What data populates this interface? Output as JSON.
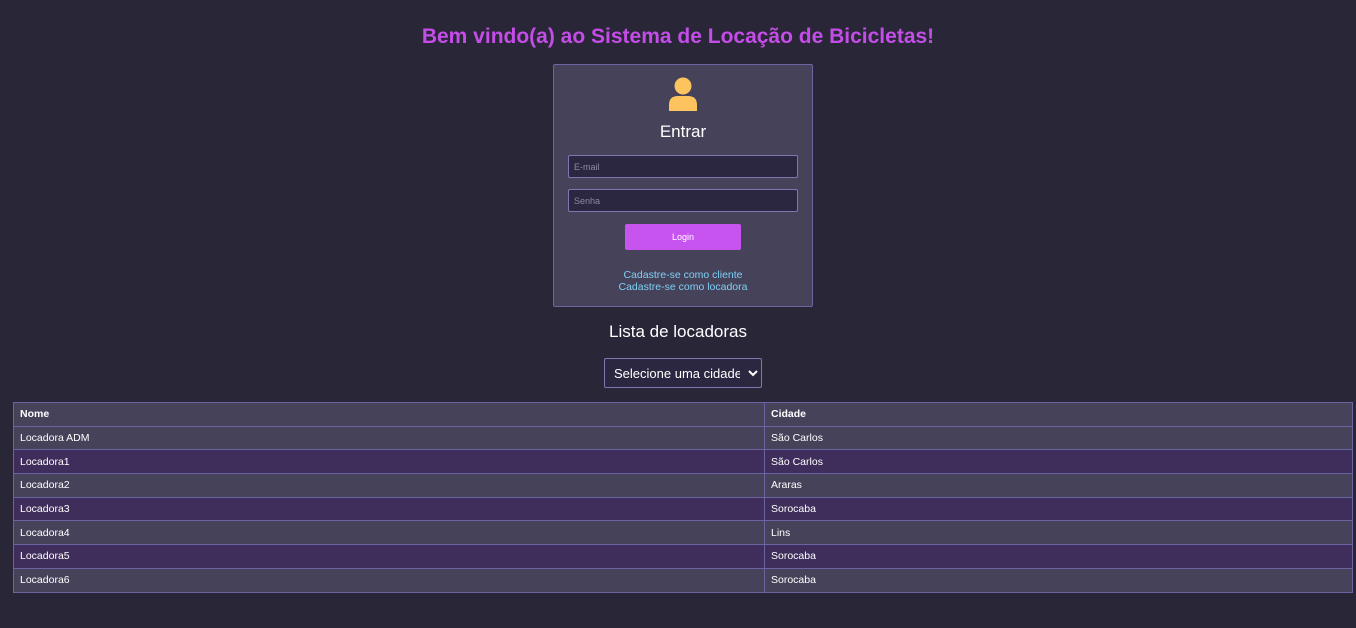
{
  "header": {
    "title": "Bem vindo(a) ao Sistema de Locação de Bicicletas!"
  },
  "login": {
    "icon": "user-icon",
    "heading": "Entrar",
    "email_placeholder": "E-mail",
    "email_value": "",
    "password_placeholder": "Senha",
    "password_value": "",
    "button_label": "Login",
    "register_client_link": "Cadastre-se como cliente",
    "register_rental_link": "Cadastre-se como locadora"
  },
  "list": {
    "title": "Lista de locadoras",
    "city_select": {
      "selected": "Selecione uma cidade"
    }
  },
  "table": {
    "columns": [
      "Nome",
      "Cidade"
    ],
    "rows": [
      {
        "nome": "Locadora ADM",
        "cidade": "São Carlos"
      },
      {
        "nome": "Locadora1",
        "cidade": "São Carlos"
      },
      {
        "nome": "Locadora2",
        "cidade": "Araras"
      },
      {
        "nome": "Locadora3",
        "cidade": "Sorocaba"
      },
      {
        "nome": "Locadora4",
        "cidade": "Lins"
      },
      {
        "nome": "Locadora5",
        "cidade": "Sorocaba"
      },
      {
        "nome": "Locadora6",
        "cidade": "Sorocaba"
      }
    ]
  },
  "colors": {
    "background": "#292638",
    "accent": "#c44de8",
    "panel": "#46425a",
    "row_alt": "#3f2d5b",
    "link": "#7fd0f6",
    "icon": "#fcc35e"
  }
}
